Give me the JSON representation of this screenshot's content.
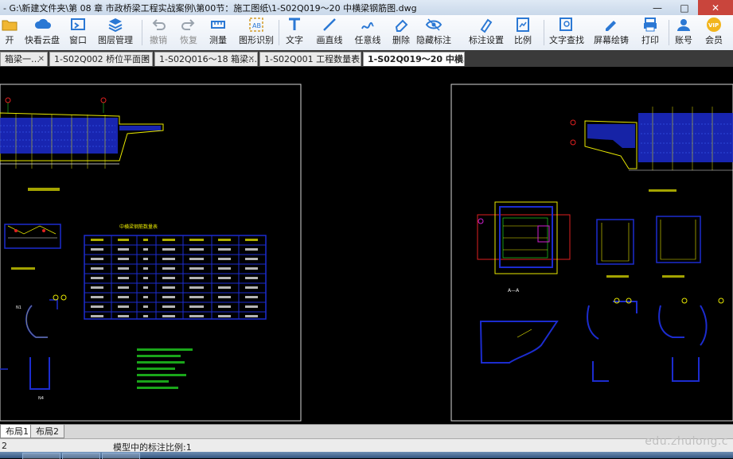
{
  "window": {
    "title": "- G:\\新建文件夹\\第 08 章 市政桥梁工程实战案例\\第00节：施工图纸\\1-S02Q019～20 中横梁钢筋图.dwg"
  },
  "toolbar": [
    {
      "label": "开",
      "icon": "folder-open-icon"
    },
    {
      "label": "快看云盘",
      "icon": "cloud-icon"
    },
    {
      "label": "窗口",
      "icon": "window-icon"
    },
    {
      "label": "图层管理",
      "icon": "layers-icon"
    },
    {
      "label": "撤销",
      "icon": "undo-icon"
    },
    {
      "label": "恢复",
      "icon": "redo-icon"
    },
    {
      "label": "测量",
      "icon": "measure-icon"
    },
    {
      "label": "图形识别",
      "icon": "shape-recognize-icon"
    },
    {
      "label": "文字",
      "icon": "text-icon"
    },
    {
      "label": "画直线",
      "icon": "line-icon"
    },
    {
      "label": "任意线",
      "icon": "freehand-icon"
    },
    {
      "label": "删除",
      "icon": "eraser-icon"
    },
    {
      "label": "隐藏标注",
      "icon": "eye-icon"
    },
    {
      "label": "标注设置",
      "icon": "annotation-settings-icon"
    },
    {
      "label": "比例",
      "icon": "scale-icon"
    },
    {
      "label": "文字查找",
      "icon": "text-search-icon"
    },
    {
      "label": "屏幕绘铸",
      "icon": "screen-draw-icon"
    },
    {
      "label": "打印",
      "icon": "print-icon"
    },
    {
      "label": "账号",
      "icon": "account-icon"
    },
    {
      "label": "会员",
      "icon": "vip-icon",
      "badge": "VIP"
    }
  ],
  "tabs": [
    {
      "label": "箱梁一…"
    },
    {
      "label": "1-S02Q002 桥位平面图"
    },
    {
      "label": "1-S02Q016～18 箱梁…"
    },
    {
      "label": "1-S02Q001 工程数量表"
    },
    {
      "label": "1-S02Q019～20 中横…",
      "active": true
    }
  ],
  "layout_tabs": [
    {
      "label": "布局1",
      "active": true
    },
    {
      "label": "布局2"
    }
  ],
  "status": {
    "left": "2",
    "scale_text": "模型中的标注比例:1"
  },
  "watermark": "edu.zhulong.c",
  "drawing": {
    "left_table_title": "中横梁钢筋数量表",
    "right_label_aa": "A—A"
  },
  "colors": {
    "toolbar_icon": "#2b78d4",
    "drawing_yellow": "#e8e800",
    "drawing_blue": "#1c2ccf",
    "drawing_white": "#f2f2f2",
    "drawing_red": "#e02020",
    "drawing_green": "#20d020",
    "drawing_magenta": "#d020d0"
  }
}
